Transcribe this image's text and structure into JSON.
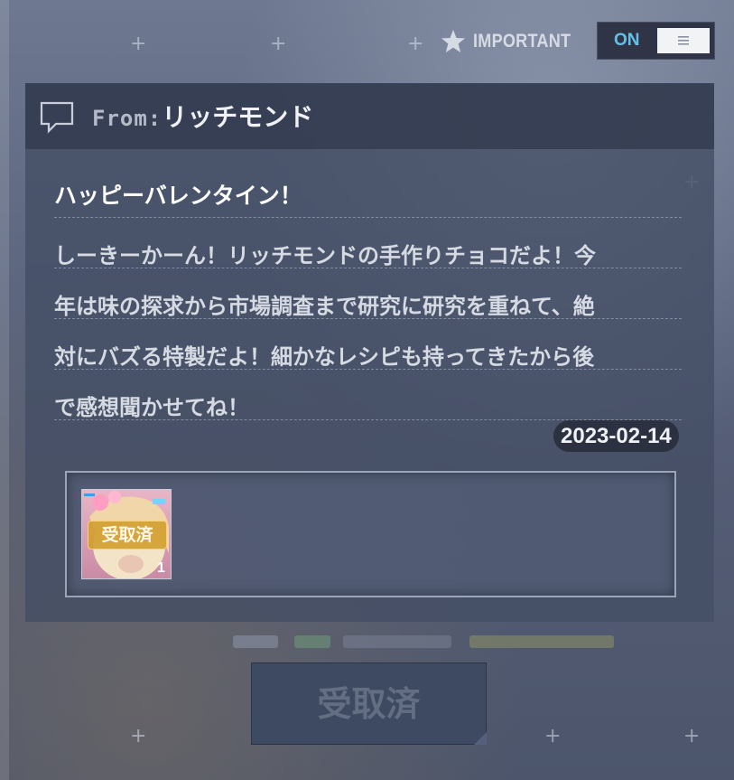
{
  "important": {
    "label": "IMPORTANT",
    "icon": "star-icon"
  },
  "toggle": {
    "state_label": "ON",
    "icon": "menu-lines-icon"
  },
  "mail": {
    "from_prefix": "From:",
    "sender": "リッチモンド",
    "subject": "ハッピーバレンタイン！",
    "body_lines": [
      "しーきーかーん！リッチモンドの手作りチョコだよ！今",
      "年は味の探求から市場調査まで研究に研究を重ねて、絶",
      "対にバズる特製だよ！細かなレシピも持ってきたから後",
      "で感想聞かせてね！"
    ],
    "date": "2023-02-14"
  },
  "attachment": {
    "badge": "受取済",
    "count": "1"
  },
  "claim_button": {
    "label": "受取済"
  },
  "colors": {
    "accent_on": "#64c0e8",
    "badge_gold": "#d2a032",
    "panel": "#444e64"
  }
}
